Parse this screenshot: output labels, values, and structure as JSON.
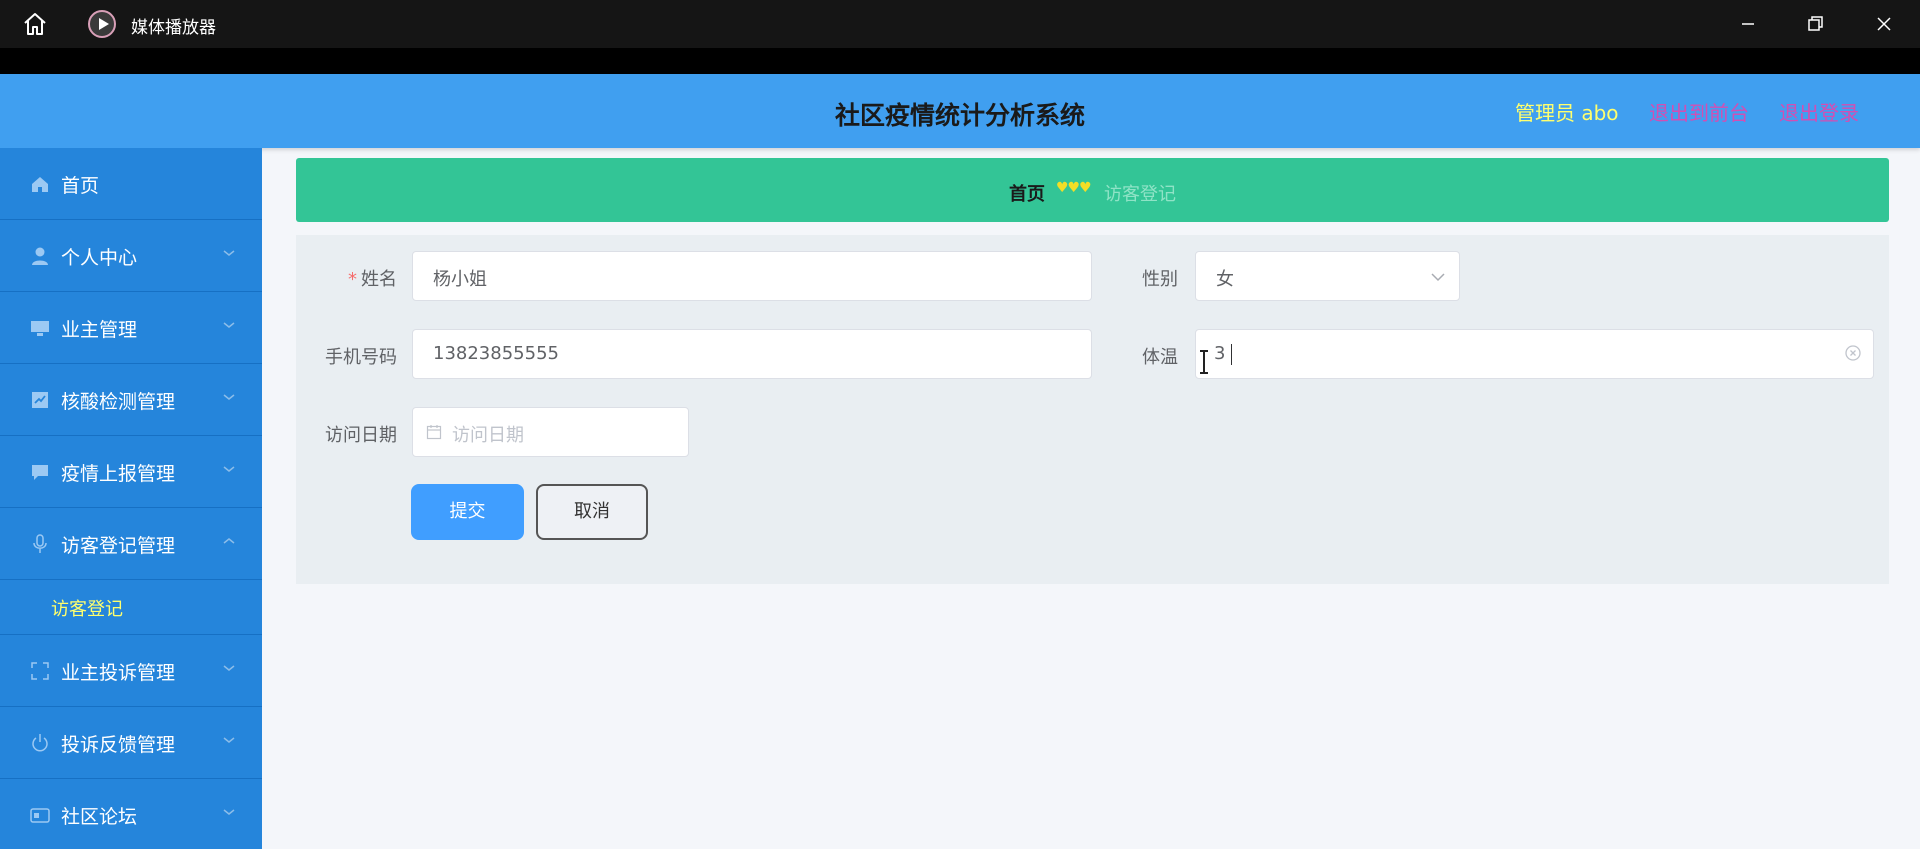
{
  "window": {
    "app_title": "媒体播放器"
  },
  "header": {
    "system_title": "社区疫情统计分析系统",
    "admin_text": "管理员 abo",
    "back_to_front": "退出到前台",
    "logout": "退出登录"
  },
  "sidebar": {
    "items": [
      {
        "label": "首页",
        "icon": "home-icon",
        "has_chevron": false
      },
      {
        "label": "个人中心",
        "icon": "user-icon",
        "has_chevron": true
      },
      {
        "label": "业主管理",
        "icon": "monitor-icon",
        "has_chevron": true
      },
      {
        "label": "核酸检测管理",
        "icon": "chart-icon",
        "has_chevron": true
      },
      {
        "label": "疫情上报管理",
        "icon": "chat-icon",
        "has_chevron": true
      },
      {
        "label": "访客登记管理",
        "icon": "microphone-icon",
        "has_chevron": true,
        "expanded": true
      },
      {
        "label": "业主投诉管理",
        "icon": "fullscreen-icon",
        "has_chevron": true
      },
      {
        "label": "投诉反馈管理",
        "icon": "power-icon",
        "has_chevron": true
      },
      {
        "label": "社区论坛",
        "icon": "id-card-icon",
        "has_chevron": true
      }
    ],
    "submenu_active": "访客登记"
  },
  "breadcrumb": {
    "home": "首页",
    "separator": "♥♥♥",
    "current": "访客登记"
  },
  "form": {
    "name_label": "姓名",
    "name_value": "杨小姐",
    "gender_label": "性别",
    "gender_value": "女",
    "phone_label": "手机号码",
    "phone_value": "13823855555",
    "temp_label": "体温",
    "temp_value": "3",
    "date_label": "访问日期",
    "date_placeholder": "访问日期",
    "submit": "提交",
    "cancel": "取消"
  },
  "colors": {
    "header_bg": "#409ff0",
    "sidebar_bg": "#2585db",
    "breadcrumb_bg": "#33c596",
    "accent_yellow": "#ffff6e",
    "accent_pink": "#d24fb3",
    "primary_button": "#409eff"
  }
}
